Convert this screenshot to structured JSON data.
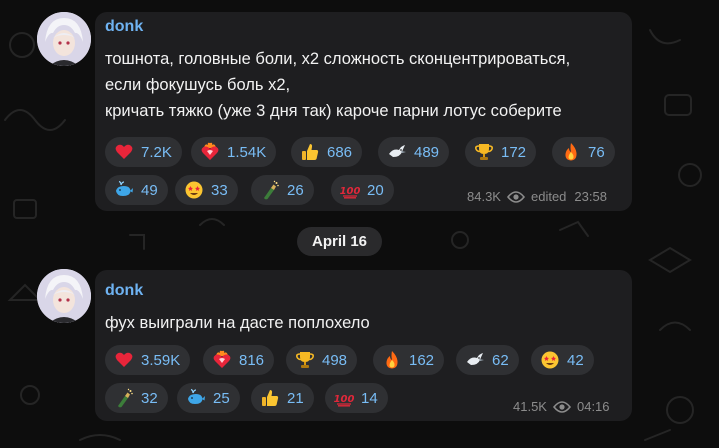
{
  "date_divider": "April 16",
  "messages": [
    {
      "author": "donk",
      "lines": [
        "тошнота, головные боли, x2 сложность сконцентрироваться,",
        "если фокушусь боль x2,",
        "кричать тяжко (уже 3 дня так) кароче парни лотус соберите"
      ],
      "reactions": [
        {
          "icon": "red-heart-icon",
          "count": "7.2K"
        },
        {
          "icon": "heart-on-fire-icon",
          "count": "1.54K"
        },
        {
          "icon": "thumbs-up-icon",
          "count": "686"
        },
        {
          "icon": "dove-icon",
          "count": "489"
        },
        {
          "icon": "trophy-icon",
          "count": "172"
        },
        {
          "icon": "fire-icon",
          "count": "76"
        },
        {
          "icon": "whale-icon",
          "count": "49"
        },
        {
          "icon": "star-struck-icon",
          "count": "33"
        },
        {
          "icon": "champagne-icon",
          "count": "26"
        },
        {
          "icon": "hundred-points-icon",
          "count": "20"
        }
      ],
      "views": "84.3K",
      "status": "edited",
      "time": "23:58"
    },
    {
      "author": "donk",
      "lines": [
        "фух выиграли на дасте поплохело"
      ],
      "reactions": [
        {
          "icon": "red-heart-icon",
          "count": "3.59K"
        },
        {
          "icon": "heart-on-fire-icon",
          "count": "816"
        },
        {
          "icon": "trophy-icon",
          "count": "498"
        },
        {
          "icon": "fire-icon",
          "count": "162"
        },
        {
          "icon": "dove-icon",
          "count": "62"
        },
        {
          "icon": "star-struck-icon",
          "count": "42"
        },
        {
          "icon": "champagne-icon",
          "count": "32"
        },
        {
          "icon": "whale-icon",
          "count": "25"
        },
        {
          "icon": "thumbs-up-icon",
          "count": "21"
        },
        {
          "icon": "hundred-points-icon",
          "count": "14"
        }
      ],
      "views": "41.5K",
      "status": "",
      "time": "04:16"
    }
  ],
  "colors": {
    "accent": "#6fb3f2",
    "reaction_count": "#79bdf6",
    "bubble": "#1e1e20",
    "reaction_bg": "#2f3033",
    "meta": "#8c8c8c"
  }
}
